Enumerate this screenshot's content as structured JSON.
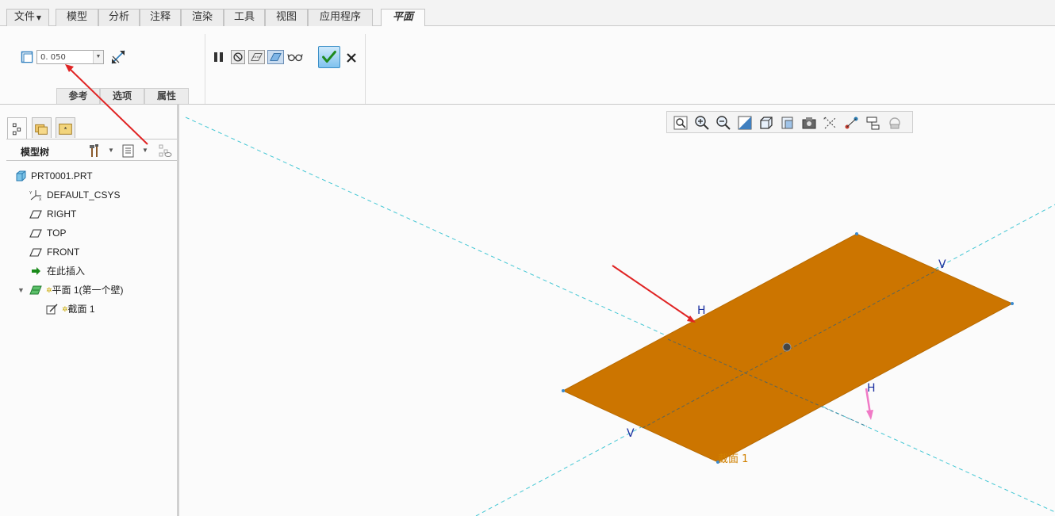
{
  "menu": {
    "file": "文件",
    "model": "模型",
    "analysis": "分析",
    "annotate": "注释",
    "render": "渲染",
    "tools": "工具",
    "view": "视图",
    "apps": "应用程序",
    "active_tab": "平面"
  },
  "ribbon": {
    "thickness_value": "0. 050",
    "tabs": {
      "refs": "参考",
      "options": "选项",
      "props": "属性"
    }
  },
  "tree": {
    "title": "模型树",
    "items": [
      {
        "label": "PRT0001.PRT",
        "icon": "part-icon"
      },
      {
        "label": "DEFAULT_CSYS",
        "icon": "csys-icon"
      },
      {
        "label": "RIGHT",
        "icon": "datum-plane-icon"
      },
      {
        "label": "TOP",
        "icon": "datum-plane-icon"
      },
      {
        "label": "FRONT",
        "icon": "datum-plane-icon"
      },
      {
        "label": "在此插入",
        "icon": "insert-arrow-icon"
      },
      {
        "label": "平面 1(第一个壁)",
        "icon": "sheetmetal-planar-icon"
      },
      {
        "label": "截面 1",
        "icon": "sketch-icon"
      }
    ]
  },
  "scene": {
    "h_label_top": "H",
    "v_label_right": "V",
    "h_label_bottom": "H",
    "v_label_left": "V",
    "section_label": "截面 1",
    "plate_color": "#cc7500",
    "axis_color": "#44c7d4",
    "arrow_color": "#e02424"
  }
}
